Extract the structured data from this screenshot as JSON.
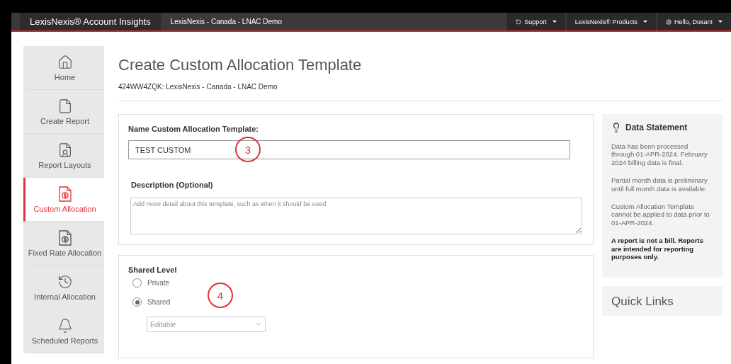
{
  "header": {
    "brand": "LexisNexis® Account Insights",
    "account": "LexisNexis - Canada - LNAC Demo",
    "menus": [
      {
        "kind": "support",
        "label": "Support"
      },
      {
        "kind": "products",
        "label": "LexisNexis® Products"
      },
      {
        "kind": "user",
        "label": "Hello, Dusan!"
      }
    ]
  },
  "sidebar": {
    "items": [
      {
        "kind": "home",
        "label": "Home",
        "selected": false
      },
      {
        "kind": "file",
        "label": "Create Report",
        "selected": false
      },
      {
        "kind": "layout",
        "label": "Report Layouts",
        "selected": false
      },
      {
        "kind": "money",
        "label": "Custom Allocation",
        "selected": true
      },
      {
        "kind": "money",
        "label": "Fixed Rate Allocation",
        "selected": false
      },
      {
        "kind": "history",
        "label": "Internal Allocation",
        "selected": false
      },
      {
        "kind": "bell",
        "label": "Scheduled Reports",
        "selected": false
      }
    ]
  },
  "page": {
    "title": "Create Custom Allocation Template",
    "subtitle": "424WW4ZQK: LexisNexis - Canada - LNAC Demo"
  },
  "name_section": {
    "label": "Name Custom Allocation Template:",
    "value": "TEST CUSTOM",
    "callout": "3"
  },
  "description": {
    "label": "Description (Optional)",
    "placeholder": "Add more detail about this template, such as when it should be used"
  },
  "shared_level": {
    "label": "Shared Level",
    "options": [
      {
        "label": "Private",
        "selected": false
      },
      {
        "label": "Shared",
        "selected": true
      }
    ],
    "select": {
      "value": "Editable"
    },
    "callout": "4"
  },
  "data_statement": {
    "title": "Data Statement",
    "paragraphs": [
      {
        "text": "Data has been processed through 01-APR-2024. February 2024 billing data is final.",
        "bold": false
      },
      {
        "text": "Partial month data is preliminary until full month data is available.",
        "bold": false
      },
      {
        "text": "Custom Allocation Template cannot be applied to data prior to 01-APR-2024.",
        "bold": false
      },
      {
        "text": "A report is not a bill. Reports are intended for reporting purposes only.",
        "bold": true
      }
    ]
  },
  "quick_links": {
    "title": "Quick Links"
  }
}
